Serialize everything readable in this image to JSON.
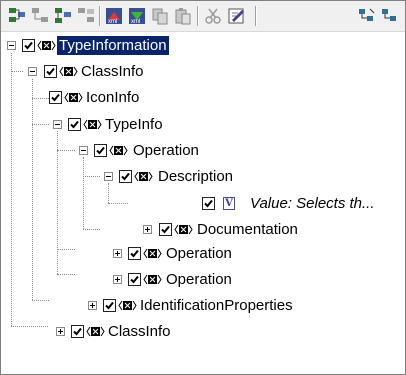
{
  "toolbar": {
    "buttons": [
      {
        "icon": "add-sibling-icon"
      },
      {
        "icon": "add-child-icon"
      },
      {
        "icon": "insert-node-icon"
      },
      {
        "icon": "remove-node-icon"
      },
      {
        "icon": "xml-import-icon"
      },
      {
        "icon": "xml-export-icon"
      },
      {
        "icon": "copy-icon"
      },
      {
        "icon": "paste-icon"
      },
      {
        "icon": "cut-icon"
      },
      {
        "icon": "edit-icon"
      },
      {
        "icon": "view-tree-icon"
      },
      {
        "icon": "view-list-icon"
      }
    ]
  },
  "tree": {
    "nodes": [
      {
        "label": "TypeInformation",
        "selected": true
      },
      {
        "label": "ClassInfo"
      },
      {
        "label": "IconInfo"
      },
      {
        "label": "TypeInfo"
      },
      {
        "label": "Operation"
      },
      {
        "label": "Description"
      },
      {
        "label": "Value: Selects th...",
        "value_icon_letter": "V"
      },
      {
        "label": "Documentation"
      },
      {
        "label": "Operation"
      },
      {
        "label": "Operation"
      },
      {
        "label": "IdentificationProperties"
      },
      {
        "label": "ClassInfo"
      }
    ]
  },
  "colors": {
    "selection": "#0a246a",
    "element_icon": "#000000",
    "value_icon": "#3e3e9e"
  }
}
